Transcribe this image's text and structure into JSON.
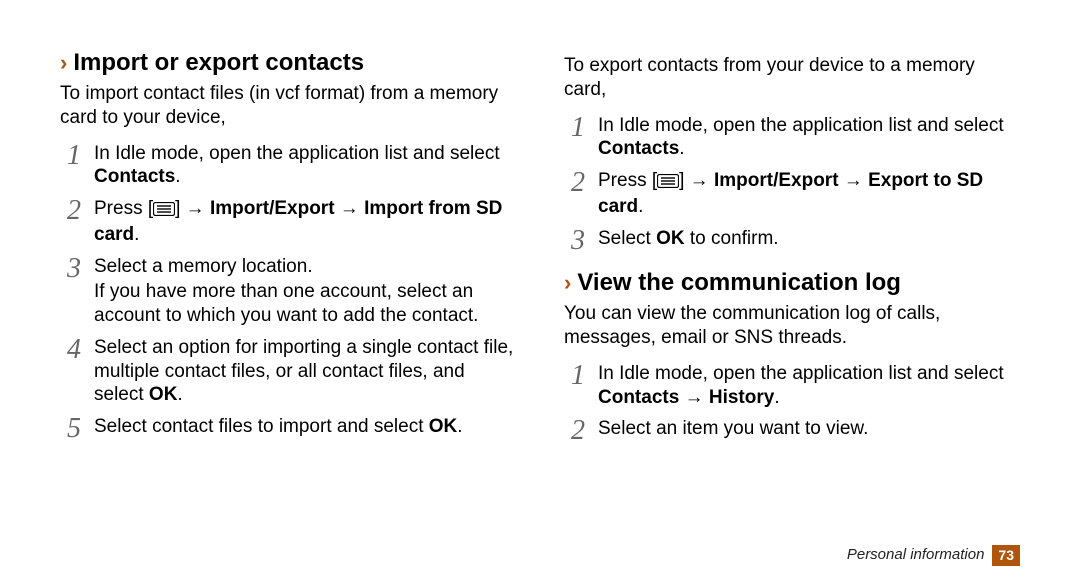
{
  "left": {
    "heading": "Import or export contacts",
    "intro": "To import contact files (in vcf format) from a memory card to your device,",
    "steps": [
      {
        "pre": "In Idle mode, open the application list and select ",
        "bold": "Contacts",
        "post": "."
      },
      {
        "pre": "Press [",
        "icon": true,
        "post1": "] → ",
        "bold": "Import/Export → Import from SD card",
        "post2": "."
      },
      {
        "pre": "Select a memory location.",
        "sub": "If you have more than one account, select an account to which you want to add the contact."
      },
      {
        "pre": "Select an option for importing a single contact file, multiple contact files, or all contact files, and select ",
        "bold": "OK",
        "post": "."
      },
      {
        "pre": "Select contact files to import and select ",
        "bold": "OK",
        "post": "."
      }
    ]
  },
  "right": {
    "export_intro": "To export contacts from your device to a memory card,",
    "export_steps": [
      {
        "pre": "In Idle mode, open the application list and select ",
        "bold": "Contacts",
        "post": "."
      },
      {
        "pre": "Press [",
        "icon": true,
        "post1": "] → ",
        "bold": "Import/Export → Export to SD card",
        "post2": "."
      },
      {
        "pre": "Select ",
        "bold": "OK",
        "post": " to confirm."
      }
    ],
    "heading2": "View the communication log",
    "intro2": "You can view the communication log of calls, messages, email or SNS threads.",
    "log_steps": [
      {
        "pre": "In Idle mode, open the application list and select ",
        "bold": "Contacts → History",
        "post": "."
      },
      {
        "pre": "Select an item you want to view."
      }
    ]
  },
  "footer": {
    "label": "Personal information",
    "page": "73"
  }
}
